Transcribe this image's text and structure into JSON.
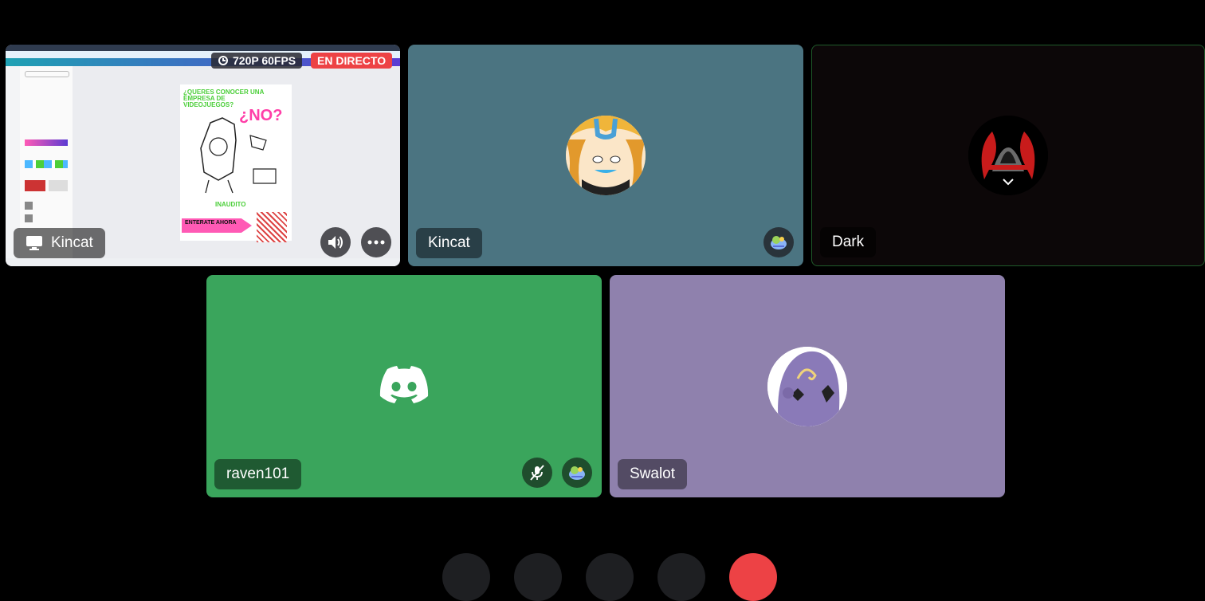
{
  "tiles": {
    "stream": {
      "name": "Kincat",
      "quality": "720P 60FPS",
      "live": "EN DIRECTO",
      "poster": {
        "headline": "¿QUERES CONOCER UNA EMPRESA DE VIDEOJUEGOS?",
        "big": "¿NO?",
        "brand": "INAUDITO",
        "cta": "ENTERATE AHORA"
      }
    },
    "kincat": {
      "name": "Kincat"
    },
    "dark": {
      "name": "Dark"
    },
    "raven": {
      "name": "raven101"
    },
    "swalot": {
      "name": "Swalot"
    }
  },
  "colors": {
    "stream_bg": "#e7e9ec",
    "kincat_bg": "#4b7481",
    "dark_bg": "#0c0708",
    "raven_bg": "#3aa55c",
    "swalot_bg": "#8f81ad",
    "live_red": "#ed4245",
    "hangup_red": "#ed4245"
  },
  "icons": [
    "screen-share-icon",
    "volume-icon",
    "more-icon",
    "activity-icon",
    "mic-muted-icon",
    "discord-logo-icon"
  ]
}
